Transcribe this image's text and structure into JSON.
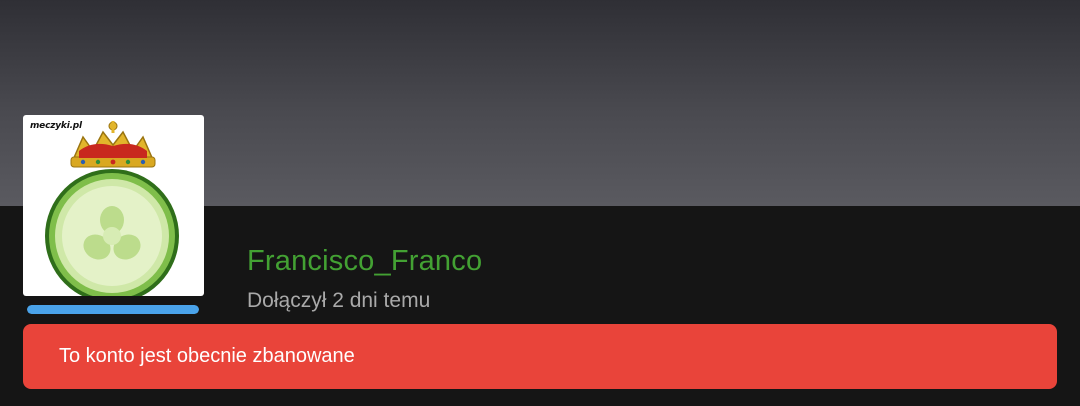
{
  "profile": {
    "username": "Francisco_Franco",
    "joined_text": "Dołączył 2 dni temu",
    "avatar_watermark": "meczyki.pl",
    "level_progress_percent": 100
  },
  "ban": {
    "message": "To konto jest obecnie zbanowane"
  },
  "colors": {
    "username": "#43a133",
    "level_bar": "#4aa3ea",
    "ban_banner": "#e9443a",
    "background": "#151515"
  }
}
